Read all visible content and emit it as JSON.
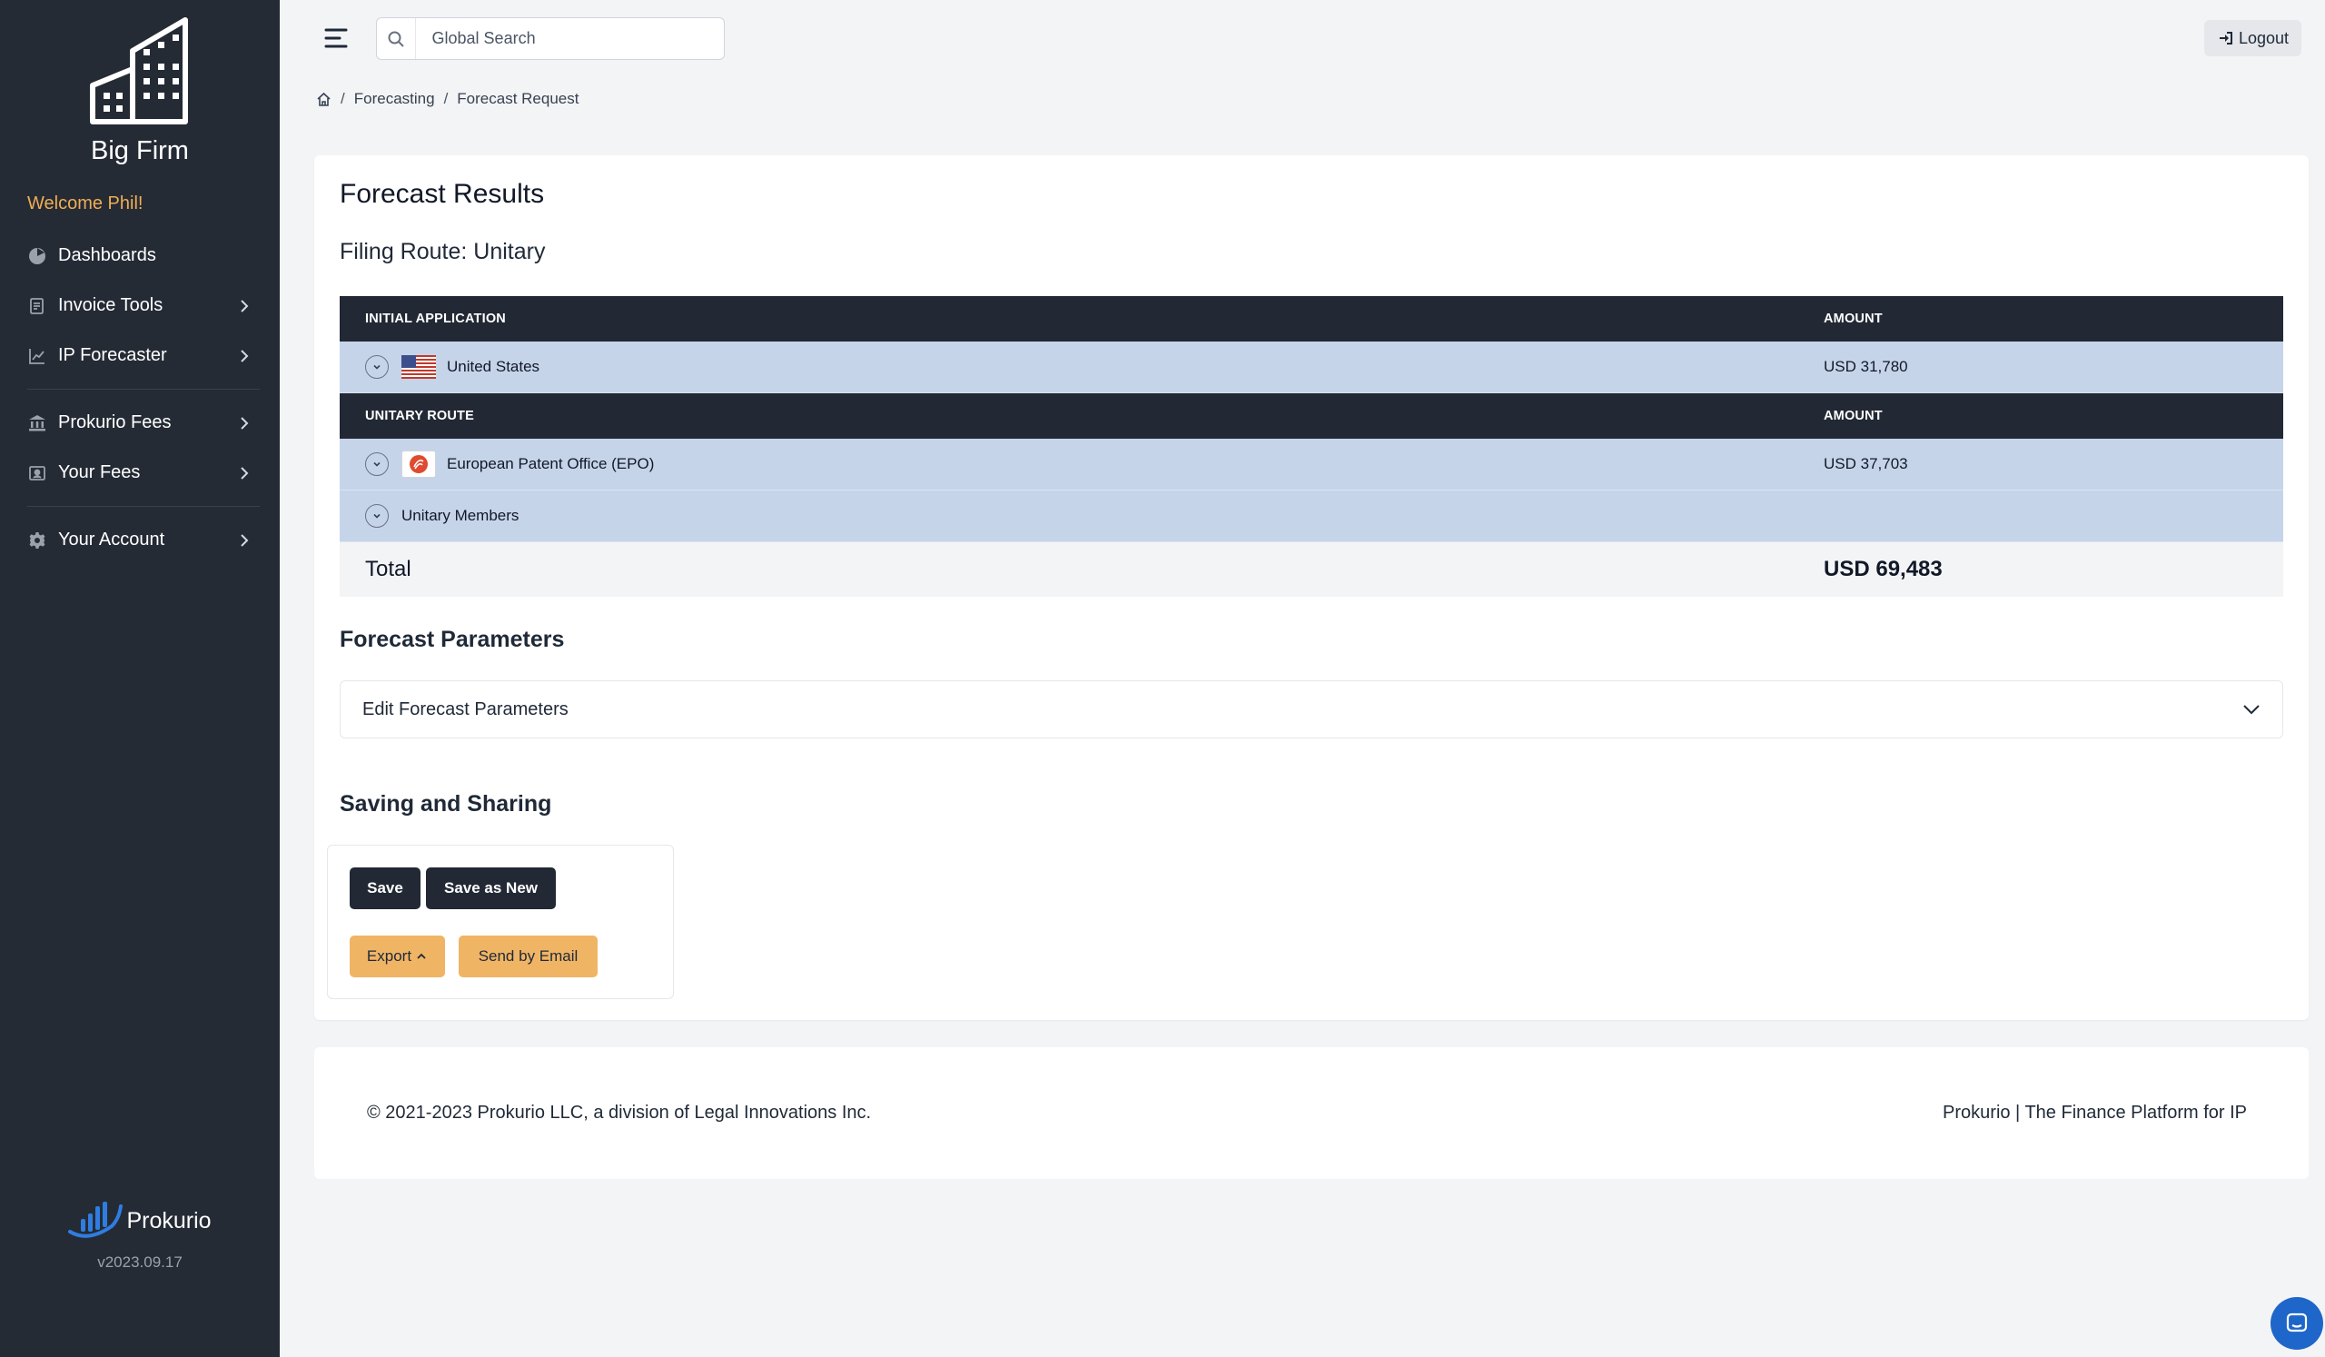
{
  "sidebar": {
    "brand": "Big Firm",
    "welcome": "Welcome Phil!",
    "items": [
      {
        "label": "Dashboards",
        "icon": "chart-pie-icon"
      },
      {
        "label": "Invoice Tools",
        "icon": "invoice-icon"
      },
      {
        "label": "IP Forecaster",
        "icon": "chart-line-icon"
      },
      {
        "label": "Prokurio Fees",
        "icon": "bank-icon"
      },
      {
        "label": "Your Fees",
        "icon": "id-card-icon"
      },
      {
        "label": "Your Account",
        "icon": "gear-icon"
      }
    ],
    "footer_logo": "Prokurio",
    "version": "v2023.09.17"
  },
  "topbar": {
    "search_placeholder": "Global Search",
    "logout_label": "Logout"
  },
  "breadcrumb": [
    "Forecasting",
    "Forecast Request"
  ],
  "results": {
    "title": "Forecast Results",
    "filing_route": "Filing Route: Unitary",
    "initial_header": "INITIAL APPLICATION",
    "amount_header": "AMOUNT",
    "initial_rows": [
      {
        "name": "United States",
        "amount": "USD 31,780"
      }
    ],
    "unitary_header": "UNITARY ROUTE",
    "unitary_rows": [
      {
        "name": "European Patent Office (EPO)",
        "amount": "USD 37,703"
      },
      {
        "name": "Unitary Members",
        "amount": ""
      }
    ],
    "total_label": "Total",
    "total_amount": "USD 69,483"
  },
  "parameters": {
    "title": "Forecast Parameters",
    "accordion_label": "Edit Forecast Parameters"
  },
  "sharing": {
    "title": "Saving and Sharing",
    "save": "Save",
    "save_as_new": "Save as New",
    "export": "Export",
    "send_email": "Send by Email"
  },
  "footer": {
    "copyright": "© 2021-2023 Prokurio LLC, a division of Legal Innovations Inc.",
    "tagline": "Prokurio | The Finance Platform for IP"
  },
  "colors": {
    "sidebar_bg": "#252b35",
    "accent_amber": "#f0b465",
    "row_blue": "#c6d4ea",
    "header_dark": "#222834"
  }
}
